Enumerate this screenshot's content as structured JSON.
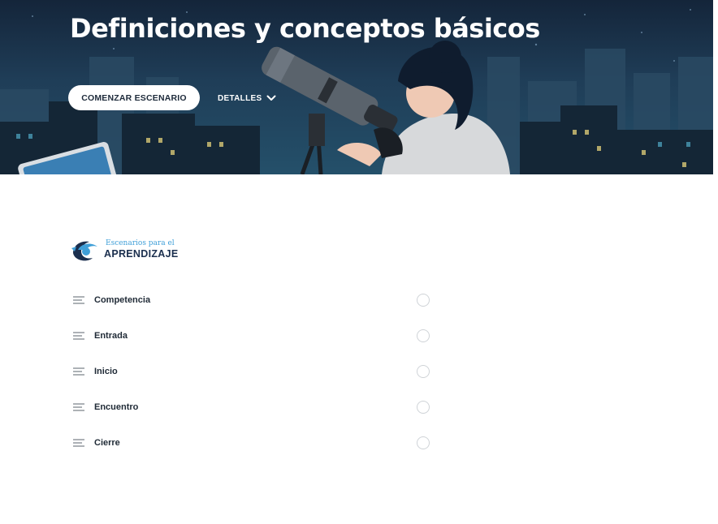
{
  "hero": {
    "title": "Definiciones y conceptos básicos",
    "start_button": "COMENZAR ESCENARIO",
    "details_label": "DETALLES",
    "details_icon": "chevron-down-icon"
  },
  "logo": {
    "top_text": "Escenarios para el",
    "main_text": "APRENDIZAJE"
  },
  "sections": [
    {
      "label": "Competencia",
      "icon": "menu-lines-icon",
      "completed": false
    },
    {
      "label": "Entrada",
      "icon": "menu-lines-icon",
      "completed": false
    },
    {
      "label": "Inicio",
      "icon": "menu-lines-icon",
      "completed": false
    },
    {
      "label": "Encuentro",
      "icon": "menu-lines-icon",
      "completed": false
    },
    {
      "label": "Cierre",
      "icon": "menu-lines-icon",
      "completed": false
    }
  ],
  "colors": {
    "hero_bg": "#1f3d57",
    "button_bg": "#ffffff",
    "logo_blue": "#3f9fd8",
    "logo_navy": "#1b2f4e",
    "status_border": "#cfd3d7"
  }
}
